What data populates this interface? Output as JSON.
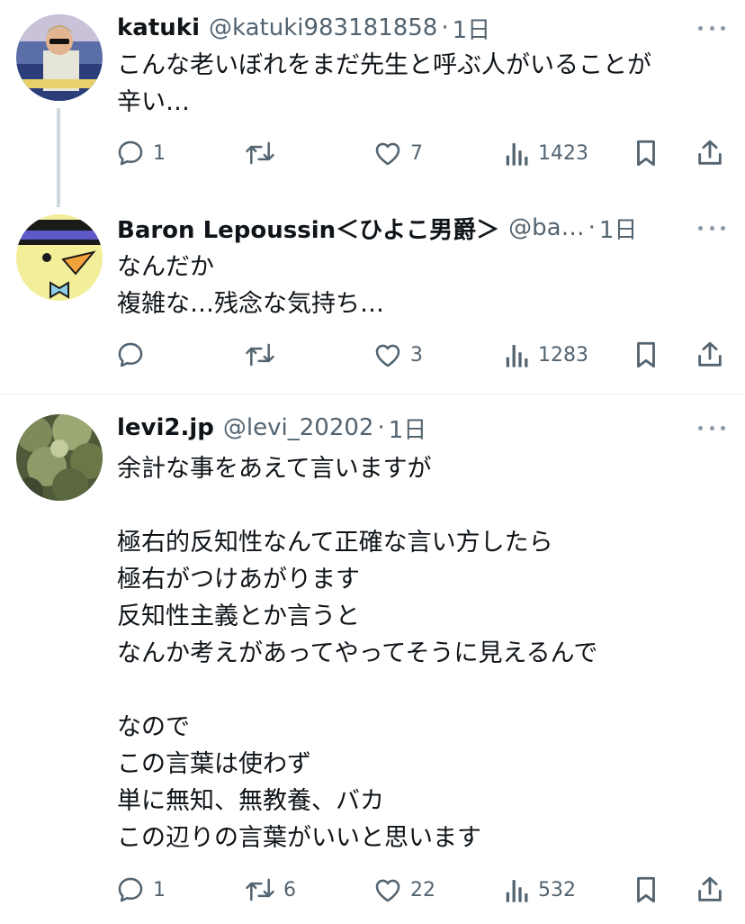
{
  "tweets": [
    {
      "name": "katuki",
      "handle": "@katuki983181858",
      "dot": "·",
      "time": "1日",
      "lines": [
        "こんな老いぼれをまだ先生と呼ぶ人がいることが",
        "辛い…"
      ],
      "replies": "1",
      "retweets": "",
      "likes": "7",
      "views": "1423"
    },
    {
      "name": "Baron Lepoussin＜ひよこ男爵＞",
      "handle": "@ba…",
      "dot": "·",
      "time": "1日",
      "lines": [
        "なんだか",
        "複雑な…残念な気持ち…"
      ],
      "replies": "",
      "retweets": "",
      "likes": "3",
      "views": "1283"
    },
    {
      "name": "levi2.jp",
      "handle": "@levi_20202",
      "dot": "·",
      "time": "1日",
      "lines": [
        "余計な事をあえて言いますが",
        "",
        "極右的反知性なんて正確な言い方したら",
        "極右がつけあがります",
        "反知性主義とか言うと",
        "なんか考えがあってやってそうに見えるんで",
        "",
        "なので",
        "この言葉は使わず",
        "単に無知、無教養、バカ",
        "この辺りの言葉がいいと思います"
      ],
      "replies": "1",
      "retweets": "6",
      "likes": "22",
      "views": "532"
    }
  ],
  "icons": {
    "reply": "reply-icon",
    "retweet": "retweet-icon",
    "like": "heart-icon",
    "views": "views-icon",
    "bookmark": "bookmark-icon",
    "share": "share-icon",
    "more": "more-icon"
  },
  "colors": {
    "text": "#0f1419",
    "secondary": "#536471",
    "line": "#cfd9de"
  }
}
